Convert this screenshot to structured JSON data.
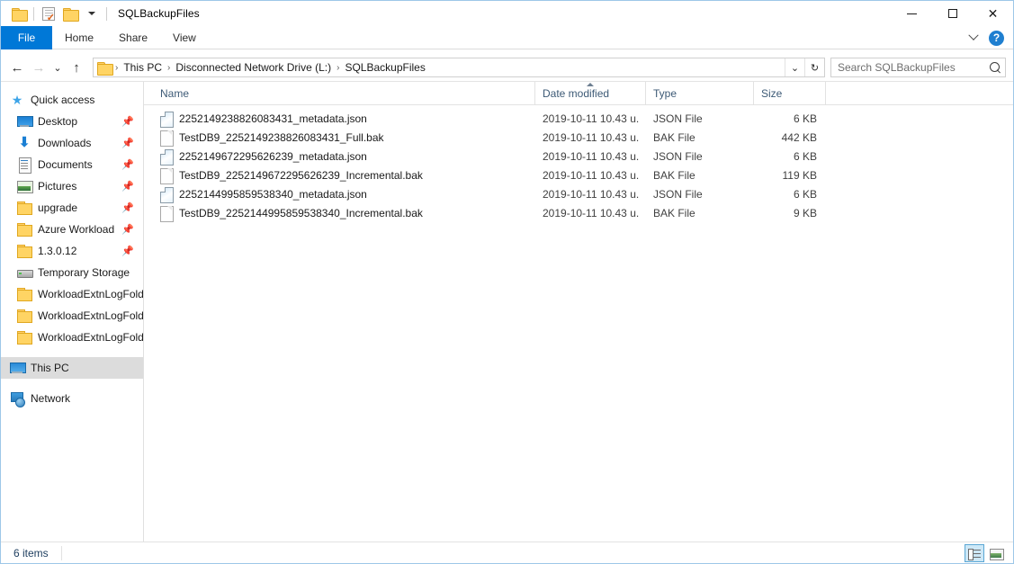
{
  "window": {
    "title": "SQLBackupFiles",
    "quick_access": [
      "folder-icon",
      "properties-icon",
      "new-folder-icon",
      "customize-chevron-icon"
    ],
    "controls": {
      "minimize": "minimize-icon",
      "maximize": "maximize-icon",
      "close": "close-icon"
    }
  },
  "ribbon": {
    "tabs": [
      {
        "label": "File",
        "active": true
      },
      {
        "label": "Home",
        "active": false
      },
      {
        "label": "Share",
        "active": false
      },
      {
        "label": "View",
        "active": false
      }
    ],
    "expand_icon": "chevron-down-icon",
    "help_label": "?"
  },
  "address": {
    "back_icon": "arrow-left-icon",
    "forward_icon": "arrow-right-icon",
    "recent_icon": "chevron-down-icon",
    "up_icon": "arrow-up-icon",
    "breadcrumb": [
      "This PC",
      "Disconnected Network Drive (L:)",
      "SQLBackupFiles"
    ],
    "separator": "›",
    "dropdown_icon": "chevron-down-icon",
    "refresh_icon": "refresh-icon"
  },
  "search": {
    "placeholder": "Search SQLBackupFiles",
    "value": "",
    "icon": "search-icon"
  },
  "sidebar": {
    "groups": [
      {
        "root": {
          "label": "Quick access",
          "icon": "star-icon"
        },
        "items": [
          {
            "label": "Desktop",
            "icon": "desktop-icon",
            "pinned": true
          },
          {
            "label": "Downloads",
            "icon": "download-icon",
            "pinned": true
          },
          {
            "label": "Documents",
            "icon": "documents-icon",
            "pinned": true
          },
          {
            "label": "Pictures",
            "icon": "pictures-icon",
            "pinned": true
          },
          {
            "label": "upgrade",
            "icon": "folder-icon",
            "pinned": true
          },
          {
            "label": "Azure Workload",
            "icon": "folder-icon",
            "pinned": true
          },
          {
            "label": "1.3.0.12",
            "icon": "folder-icon",
            "pinned": true
          },
          {
            "label": "Temporary Storage",
            "icon": "drive-icon",
            "pinned": false
          },
          {
            "label": "WorkloadExtnLogFolder",
            "icon": "folder-icon",
            "pinned": false
          },
          {
            "label": "WorkloadExtnLogFolder",
            "icon": "folder-icon",
            "pinned": false
          },
          {
            "label": "WorkloadExtnLogFolder",
            "icon": "folder-icon",
            "pinned": false
          }
        ]
      }
    ],
    "this_pc": {
      "label": "This PC",
      "icon": "pc-icon",
      "selected": true
    },
    "network": {
      "label": "Network",
      "icon": "network-icon",
      "selected": false
    }
  },
  "columns": [
    {
      "key": "name",
      "label": "Name",
      "sorted": false
    },
    {
      "key": "date",
      "label": "Date modified",
      "sorted": true,
      "direction": "asc"
    },
    {
      "key": "type",
      "label": "Type",
      "sorted": false
    },
    {
      "key": "size",
      "label": "Size",
      "sorted": false
    }
  ],
  "files": [
    {
      "name": "2252149238826083431_metadata.json",
      "date": "2019-10-11 10.43 u.",
      "type": "JSON File",
      "size": "6 KB",
      "icon": "json-file-icon"
    },
    {
      "name": "TestDB9_2252149238826083431_Full.bak",
      "date": "2019-10-11 10.43 u.",
      "type": "BAK File",
      "size": "442 KB",
      "icon": "bak-file-icon"
    },
    {
      "name": "2252149672295626239_metadata.json",
      "date": "2019-10-11 10.43 u.",
      "type": "JSON File",
      "size": "6 KB",
      "icon": "json-file-icon"
    },
    {
      "name": "TestDB9_2252149672295626239_Incremental.bak",
      "date": "2019-10-11 10.43 u.",
      "type": "BAK File",
      "size": "119 KB",
      "icon": "bak-file-icon"
    },
    {
      "name": "2252144995859538340_metadata.json",
      "date": "2019-10-11 10.43 u.",
      "type": "JSON File",
      "size": "6 KB",
      "icon": "json-file-icon"
    },
    {
      "name": "TestDB9_2252144995859538340_Incremental.bak",
      "date": "2019-10-11 10.43 u.",
      "type": "BAK File",
      "size": "9 KB",
      "icon": "bak-file-icon"
    }
  ],
  "status": {
    "item_count": "6 items",
    "views": [
      {
        "name": "details-view",
        "icon": "details-view-icon",
        "active": true
      },
      {
        "name": "large-icons-view",
        "icon": "large-icons-view-icon",
        "active": false
      }
    ]
  },
  "colors": {
    "accent": "#0078d7",
    "selection": "#dcdcdc",
    "header_text": "#3d5a76",
    "status_text": "#1f3f60"
  }
}
